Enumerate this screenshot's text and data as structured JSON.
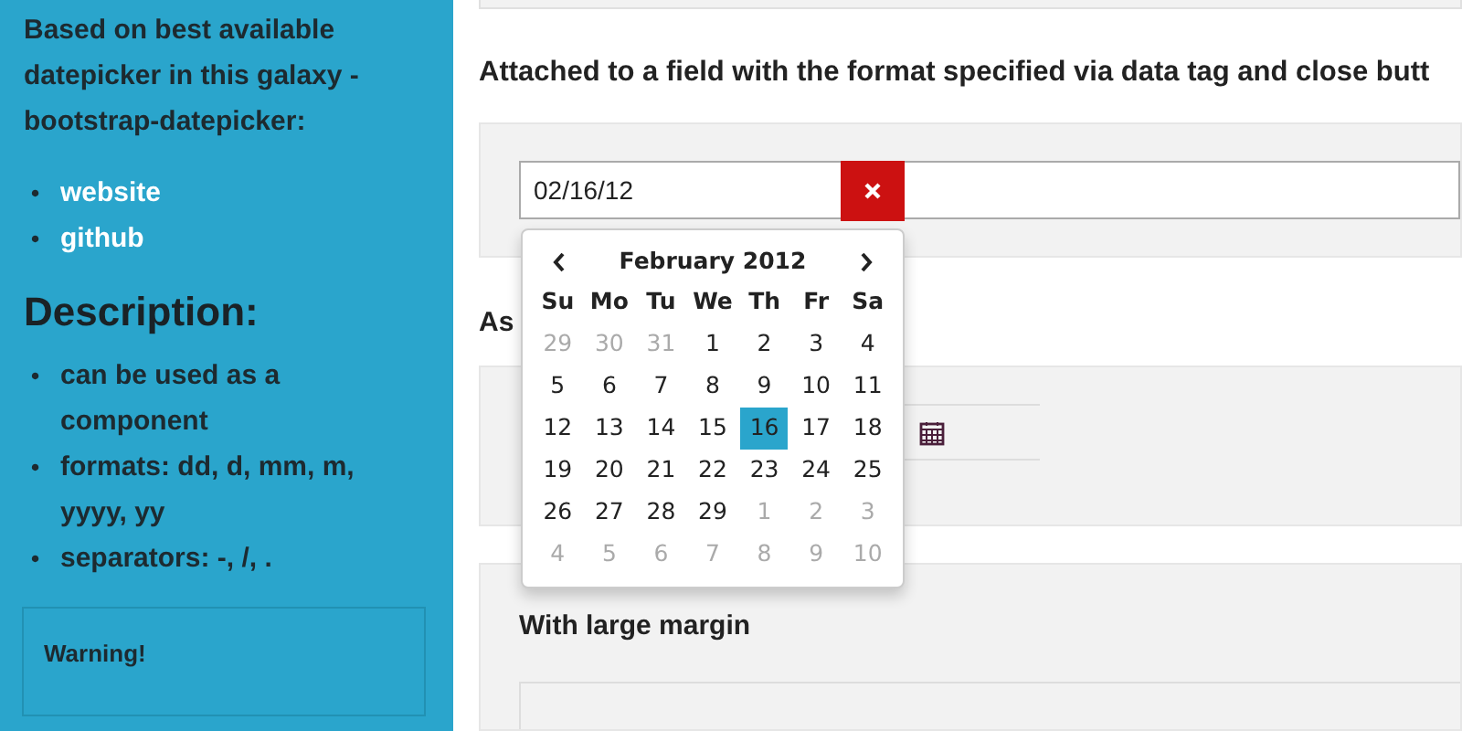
{
  "sidebar": {
    "intro": "Based on best available datepicker in this galaxy - bootstrap-datepicker:",
    "links": [
      {
        "bullet": "•",
        "text": "website"
      },
      {
        "bullet": "•",
        "text": "github"
      }
    ],
    "description_heading": "Description:",
    "features": [
      {
        "bullet": "•",
        "text": "can be used as a component"
      },
      {
        "bullet": "•",
        "text": "formats: dd, d, mm, m, yyyy, yy"
      },
      {
        "bullet": "•",
        "text": "separators: -, /, ."
      }
    ],
    "warning_title": "Warning!"
  },
  "main": {
    "heading": "Attached to a field with the format specified via data tag and close butt",
    "date_field": {
      "value": "02/16/12"
    },
    "section_heading": "As",
    "large_margin_heading": "With large margin"
  },
  "calendar": {
    "title": "February 2012",
    "weekdays": [
      "Su",
      "Mo",
      "Tu",
      "We",
      "Th",
      "Fr",
      "Sa"
    ],
    "days": [
      {
        "label": "29",
        "muted": true,
        "selected": false
      },
      {
        "label": "30",
        "muted": true,
        "selected": false
      },
      {
        "label": "31",
        "muted": true,
        "selected": false
      },
      {
        "label": "1",
        "muted": false,
        "selected": false
      },
      {
        "label": "2",
        "muted": false,
        "selected": false
      },
      {
        "label": "3",
        "muted": false,
        "selected": false
      },
      {
        "label": "4",
        "muted": false,
        "selected": false
      },
      {
        "label": "5",
        "muted": false,
        "selected": false
      },
      {
        "label": "6",
        "muted": false,
        "selected": false
      },
      {
        "label": "7",
        "muted": false,
        "selected": false
      },
      {
        "label": "8",
        "muted": false,
        "selected": false
      },
      {
        "label": "9",
        "muted": false,
        "selected": false
      },
      {
        "label": "10",
        "muted": false,
        "selected": false
      },
      {
        "label": "11",
        "muted": false,
        "selected": false
      },
      {
        "label": "12",
        "muted": false,
        "selected": false
      },
      {
        "label": "13",
        "muted": false,
        "selected": false
      },
      {
        "label": "14",
        "muted": false,
        "selected": false
      },
      {
        "label": "15",
        "muted": false,
        "selected": false
      },
      {
        "label": "16",
        "muted": false,
        "selected": true
      },
      {
        "label": "17",
        "muted": false,
        "selected": false
      },
      {
        "label": "18",
        "muted": false,
        "selected": false
      },
      {
        "label": "19",
        "muted": false,
        "selected": false
      },
      {
        "label": "20",
        "muted": false,
        "selected": false
      },
      {
        "label": "21",
        "muted": false,
        "selected": false
      },
      {
        "label": "22",
        "muted": false,
        "selected": false
      },
      {
        "label": "23",
        "muted": false,
        "selected": false
      },
      {
        "label": "24",
        "muted": false,
        "selected": false
      },
      {
        "label": "25",
        "muted": false,
        "selected": false
      },
      {
        "label": "26",
        "muted": false,
        "selected": false
      },
      {
        "label": "27",
        "muted": false,
        "selected": false
      },
      {
        "label": "28",
        "muted": false,
        "selected": false
      },
      {
        "label": "29",
        "muted": false,
        "selected": false
      },
      {
        "label": "1",
        "muted": true,
        "selected": false
      },
      {
        "label": "2",
        "muted": true,
        "selected": false
      },
      {
        "label": "3",
        "muted": true,
        "selected": false
      },
      {
        "label": "4",
        "muted": true,
        "selected": false
      },
      {
        "label": "5",
        "muted": true,
        "selected": false
      },
      {
        "label": "6",
        "muted": true,
        "selected": false
      },
      {
        "label": "7",
        "muted": true,
        "selected": false
      },
      {
        "label": "8",
        "muted": true,
        "selected": false
      },
      {
        "label": "9",
        "muted": true,
        "selected": false
      },
      {
        "label": "10",
        "muted": true,
        "selected": false
      }
    ]
  }
}
